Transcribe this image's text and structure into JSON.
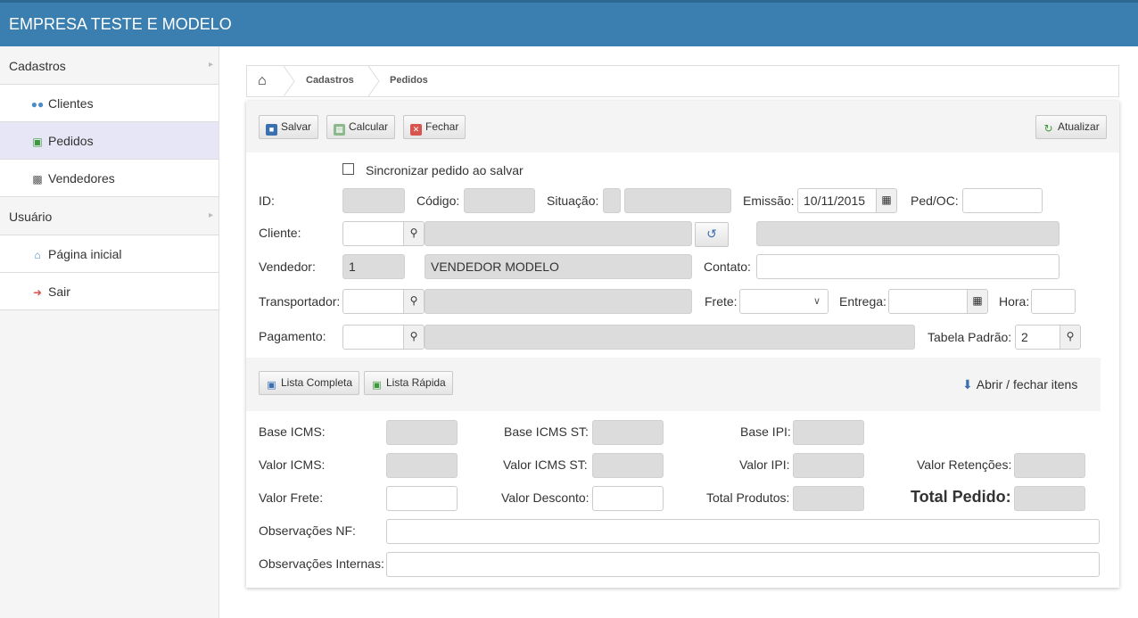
{
  "app": {
    "title": "EMPRESA TESTE E MODELO"
  },
  "sidebar": {
    "sections": [
      {
        "label": "Cadastros"
      },
      {
        "label": "Usuário"
      }
    ],
    "items": [
      {
        "label": "Clientes",
        "icon": "users-icon"
      },
      {
        "label": "Pedidos",
        "icon": "cart-icon"
      },
      {
        "label": "Vendedores",
        "icon": "sitemap-icon"
      },
      {
        "label": "Página inicial",
        "icon": "home-icon"
      },
      {
        "label": "Sair",
        "icon": "logout-icon"
      }
    ]
  },
  "breadcrumb": {
    "items": [
      "Cadastros",
      "Pedidos"
    ]
  },
  "toolbar": {
    "save": "Salvar",
    "calc": "Calcular",
    "close": "Fechar",
    "refresh": "Atualizar"
  },
  "form": {
    "sync_label": "Sincronizar pedido ao salvar",
    "id_label": "ID:",
    "codigo_label": "Código:",
    "situacao_label": "Situação:",
    "emissao_label": "Emissão:",
    "emissao_value": "10/11/2015",
    "pedoc_label": "Ped/OC:",
    "cliente_label": "Cliente:",
    "vendedor_label": "Vendedor:",
    "vendedor_code": "1",
    "vendedor_name": "VENDEDOR MODELO",
    "contato_label": "Contato:",
    "transportador_label": "Transportador:",
    "frete_label": "Frete:",
    "entrega_label": "Entrega:",
    "hora_label": "Hora:",
    "pagamento_label": "Pagamento:",
    "tabela_label": "Tabela Padrão:",
    "tabela_value": "2"
  },
  "items_bar": {
    "lista_completa": "Lista Completa",
    "lista_rapida": "Lista Rápida",
    "toggle": "Abrir / fechar itens"
  },
  "totals": {
    "base_icms": "Base ICMS:",
    "base_icms_st": "Base ICMS ST:",
    "base_ipi": "Base IPI:",
    "valor_icms": "Valor ICMS:",
    "valor_icms_st": "Valor ICMS ST:",
    "valor_ipi": "Valor IPI:",
    "valor_retencoes": "Valor Retenções:",
    "valor_frete": "Valor Frete:",
    "valor_desconto": "Valor Desconto:",
    "total_produtos": "Total Produtos:",
    "total_pedido": "Total Pedido:",
    "obs_nf": "Observações NF:",
    "obs_internas": "Observações Internas:"
  },
  "colors": {
    "header": "#3a7fb0",
    "active_item": "#e6e6f6",
    "readonly": "#dcdcdc"
  }
}
